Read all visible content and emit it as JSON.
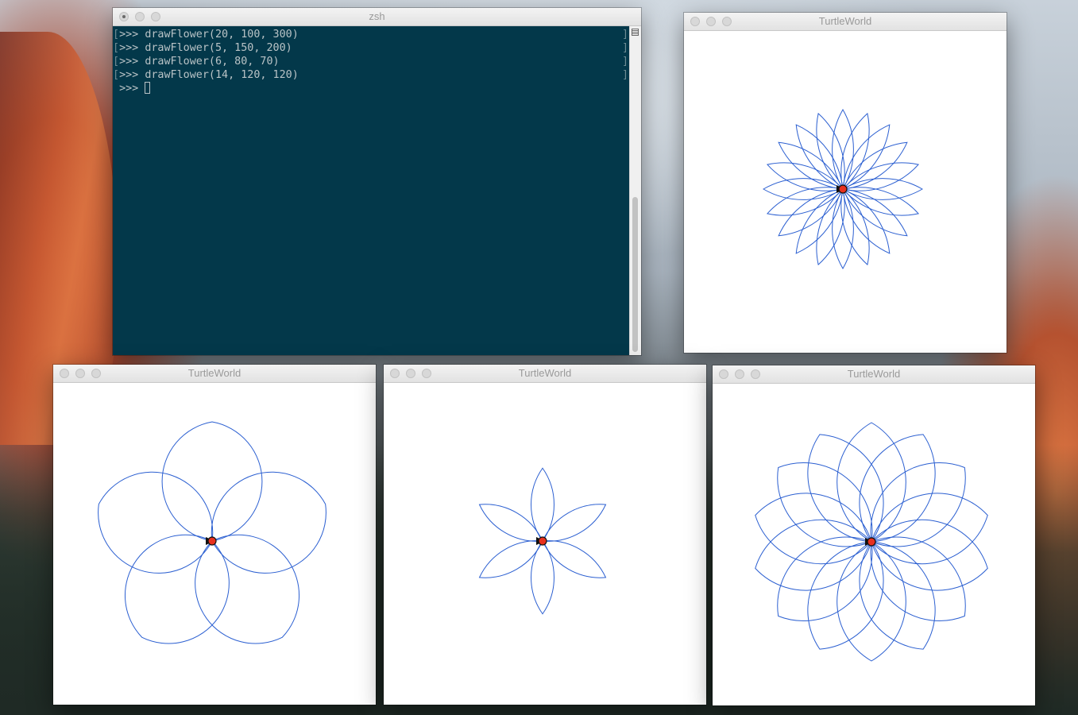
{
  "terminal": {
    "title": "zsh",
    "lines": [
      "drawFlower(20, 100, 300)",
      "drawFlower(5, 150, 200)",
      "drawFlower(6, 80, 70)",
      "drawFlower(14, 120, 120)"
    ],
    "prompt": ">>>",
    "line_marker_left": "[",
    "line_marker_right": "]"
  },
  "windows": [
    {
      "title": "TurtleWorld",
      "petals": 20,
      "length": 100,
      "angle": 300
    },
    {
      "title": "TurtleWorld",
      "petals": 5,
      "length": 150,
      "angle": 200
    },
    {
      "title": "TurtleWorld",
      "petals": 6,
      "length": 80,
      "angle": 70
    },
    {
      "title": "TurtleWorld",
      "petals": 14,
      "length": 120,
      "angle": 120
    }
  ],
  "colors": {
    "petal_stroke": "#2b5fd1",
    "turtle_fill": "#e8311f",
    "terminal_bg": "#03384a",
    "terminal_text": "#b9c3c6"
  }
}
